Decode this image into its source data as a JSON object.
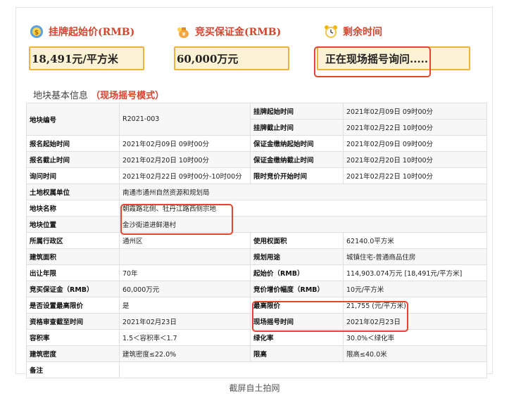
{
  "header": {
    "start_price_label": "挂牌起始价(RMB)",
    "start_price_value": "18,491元/平方米",
    "deposit_label": "竞买保证金(RMB)",
    "deposit_value": "60,000万元",
    "remaining_label": "剩余时间",
    "remaining_value": "正在现场摇号询问....."
  },
  "section": {
    "title": "地块基本信息",
    "mode": "（现场摇号模式）"
  },
  "table": {
    "r0": {
      "k1": "地块编号",
      "v1": "R2021-003",
      "k2": "挂牌起始时间",
      "v2": "2021年02月09日 09时00分"
    },
    "r0b": {
      "k2": "挂牌截止时间",
      "v2": "2021年02月22日 10时00分"
    },
    "r1": {
      "k1": "报名起始时间",
      "v1": "2021年02月09日 09时00分",
      "k2": "保证金缴纳起始时间",
      "v2": "2021年02月09日 09时00分"
    },
    "r2": {
      "k1": "报名截止时间",
      "v1": "2021年02月20日 10时00分",
      "k2": "保证金缴纳截止时间",
      "v2": "2021年02月20日 10时00分"
    },
    "r3": {
      "k1": "询问时间",
      "v1": "2021年02月22日 09时00分-10时00分",
      "k2": "限时竞价开始时间",
      "v2": "2021年02月22日 10时00分"
    },
    "r4": {
      "k1": "土地权属单位",
      "v1": "南通市通州自然资源和规划局"
    },
    "r5": {
      "k1": "地块名称",
      "v1": "朝霞路北侧、牡丹江路西侧宗地"
    },
    "r6": {
      "k1": "地块位置",
      "v1": "金沙街道进鲜港村"
    },
    "r7": {
      "k1": "所属行政区",
      "v1": "通州区",
      "k2": "使用权面积",
      "v2": "62140.0平方米"
    },
    "r8": {
      "k1": "建筑面积",
      "v1": "",
      "k2": "规划用途",
      "v2": "城镇住宅-普通商品住房"
    },
    "r9": {
      "k1": "出让年限",
      "v1": "70年",
      "k2": "起始价（RMB）",
      "v2": "114,903.074万元 [18,491元/平方米]"
    },
    "r10": {
      "k1": "竞买保证金（RMB）",
      "v1": "60,000万元",
      "k2": "竞价增价幅度（RMB）",
      "v2": "10元/平方米"
    },
    "r11": {
      "k1": "是否设置最高限价",
      "v1": "是",
      "k2": "最高限价",
      "v2": "21,755 (元/平方米)"
    },
    "r12": {
      "k1": "资格审查截至时间",
      "v1": "2021年02月23日",
      "k2": "现场摇号时间",
      "v2": "2021年02月23日"
    },
    "r13": {
      "k1": "容积率",
      "v1": "1.5＜容积率＜1.7",
      "k2": "绿化率",
      "v2": "30.0%＜绿化率"
    },
    "r14": {
      "k1": "建筑密度",
      "v1": "建筑密度≤22.0%",
      "k2": "限高",
      "v2": "限高≤40.0米"
    },
    "r15": {
      "k1": "备注",
      "v1": ""
    }
  },
  "caption": "截屏自土拍网",
  "icons": {
    "start_price": "price-coin-icon",
    "deposit": "money-bag-icon",
    "remaining": "alarm-clock-icon"
  },
  "colors": {
    "accent_red": "#d6452f",
    "highlight_border": "#e8432c",
    "box_border": "#f0b23c",
    "box_fill": "#fdf2d4"
  }
}
